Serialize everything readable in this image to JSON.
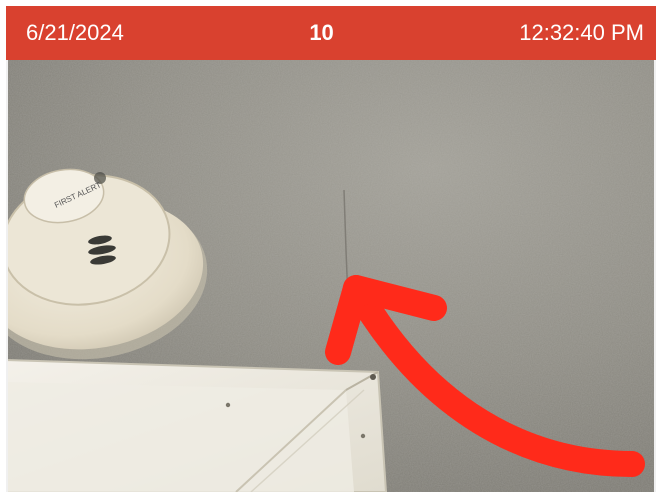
{
  "header": {
    "date": "6/21/2024",
    "count": "10",
    "time": "12:32:40 PM",
    "color": "#d9412f"
  },
  "photo": {
    "icons": [
      "smoke-detector-icon",
      "ceiling-vent-icon",
      "red-arrow-icon"
    ],
    "wall_color": "#8f8d85",
    "arrow_color": "#ff2a1a",
    "detector_text": [
      "FIRST ALERT"
    ]
  }
}
